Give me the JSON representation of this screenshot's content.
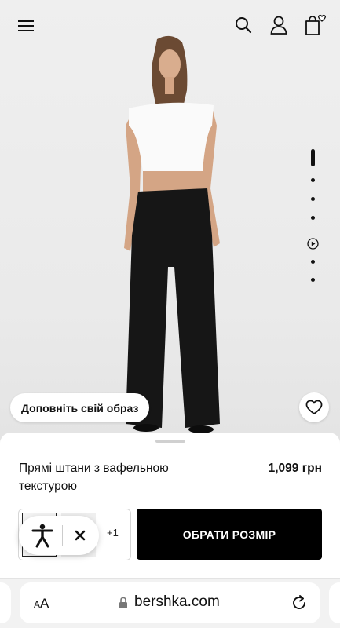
{
  "header": {
    "menu_icon": "hamburger-menu-icon",
    "search_icon": "search-icon",
    "account_icon": "user-icon",
    "bag_icon": "shopping-bag-heart-icon"
  },
  "gallery": {
    "total_items": 7,
    "active_index": 0,
    "video_index": 4,
    "complete_look_label": "Доповніть свій образ",
    "wishlist_icon": "heart-icon"
  },
  "product": {
    "name": "Прямі штани з вафельною текстурою",
    "price": "1,099 грн",
    "more_colors": "+1",
    "select_size_label": "ОБРАТИ РОЗМІР"
  },
  "accessibility": {
    "icon": "accessibility-person-icon",
    "close_icon": "close-icon"
  },
  "browser": {
    "text_size_small": "A",
    "text_size_large": "A",
    "url": "bershka.com",
    "lock_icon": "lock-icon",
    "reload_icon": "reload-icon"
  },
  "colors": {
    "accent": "#000000",
    "background": "#ececec",
    "sheet": "#ffffff"
  }
}
